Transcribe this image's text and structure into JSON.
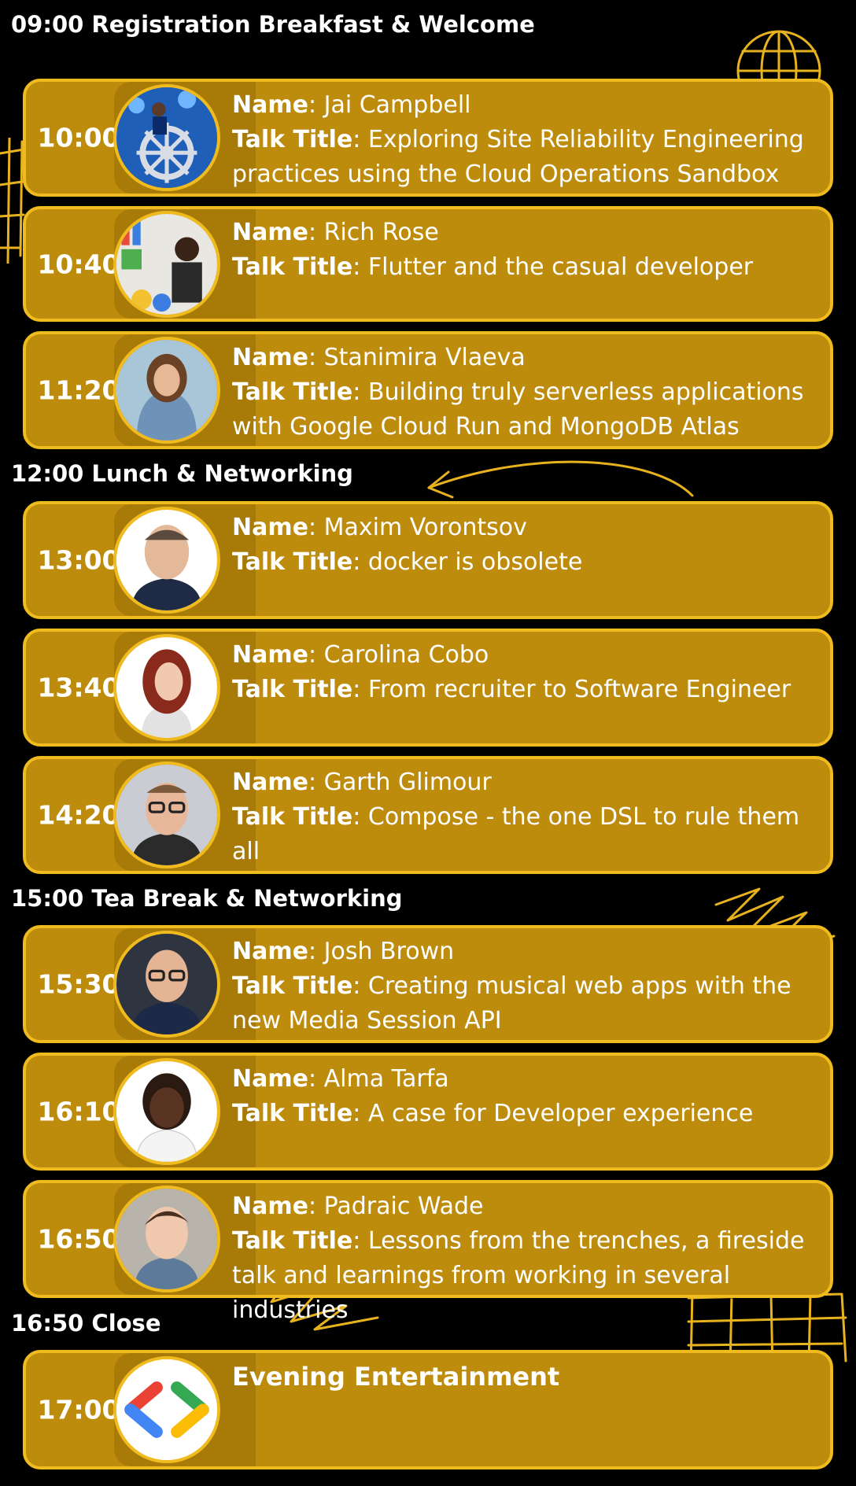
{
  "labels": {
    "name": "Name",
    "talk_title": "Talk Title"
  },
  "sections": [
    {
      "heading": "09:00 Registration Breakfast & Welcome"
    },
    {
      "heading": "12:00 Lunch & Networking"
    },
    {
      "heading": "15:00 Tea Break & Networking"
    },
    {
      "heading": "16:50 Close"
    }
  ],
  "talks": [
    {
      "time": "10:00",
      "name": "Jai Campbell",
      "title": "Exploring Site Reliability Engineering practices using the Cloud Operations Sandbox",
      "avatar": "speaker-photo-helm"
    },
    {
      "time": "10:40",
      "name": "Rich Rose",
      "title": "Flutter and the casual developer",
      "avatar": "speaker-photo"
    },
    {
      "time": "11:20",
      "name": "Stanimira Vlaeva",
      "title": "Building truly serverless applications with Google Cloud Run and MongoDB Atlas",
      "avatar": "speaker-photo"
    },
    {
      "time": "13:00",
      "name": "Maxim Vorontsov",
      "title": "docker is obsolete",
      "avatar": "speaker-photo"
    },
    {
      "time": "13:40",
      "name": "Carolina Cobo",
      "title": "From recruiter to Software Engineer",
      "avatar": "speaker-photo"
    },
    {
      "time": "14:20",
      "name": "Garth Glimour",
      "title": "Compose - the one DSL to rule them all",
      "avatar": "speaker-photo"
    },
    {
      "time": "15:30",
      "name": "Josh Brown",
      "title": "Creating musical web apps with the new Media Session API",
      "avatar": "speaker-photo"
    },
    {
      "time": "16:10",
      "name": "Alma Tarfa",
      "title": "A case for Developer experience",
      "avatar": "speaker-photo"
    },
    {
      "time": "16:50",
      "name": "Padraic Wade",
      "title": "Lessons from the trenches, a fireside talk and learnings from working in several industries",
      "avatar": "speaker-photo"
    }
  ],
  "evening": {
    "time": "17:00",
    "title": "Evening Entertainment",
    "logo": "developers-logo"
  },
  "colors": {
    "card": "#be8c0c",
    "border": "#f0bb1e",
    "background": "#000000",
    "text": "#ffffff"
  }
}
